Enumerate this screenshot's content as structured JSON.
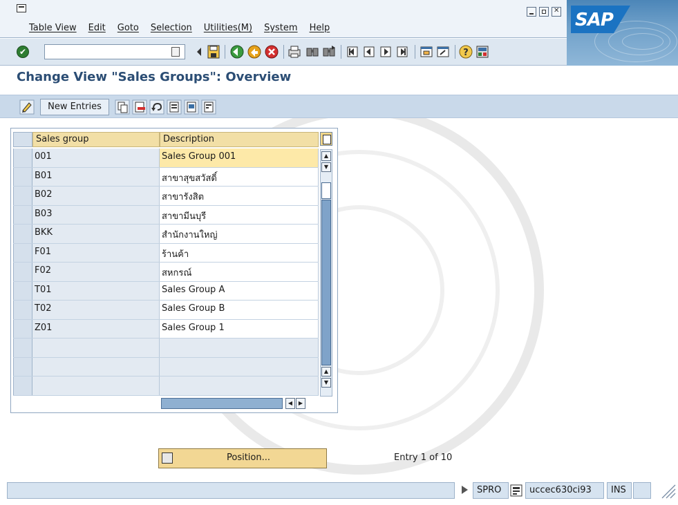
{
  "menu": {
    "items": [
      "Table View",
      "Edit",
      "Goto",
      "Selection",
      "Utilities(M)",
      "System",
      "Help"
    ]
  },
  "logo": {
    "text": "SAP"
  },
  "toolbar": {
    "command_value": "",
    "icons": [
      "enter-icon",
      "save-icon",
      "back-icon",
      "exit-icon",
      "cancel-icon",
      "print-icon",
      "find-icon",
      "find-next-icon",
      "first-page-icon",
      "previous-page-icon",
      "next-page-icon",
      "last-page-icon",
      "create-session-icon",
      "shortcut-icon",
      "help-icon",
      "customize-layout-icon"
    ]
  },
  "page": {
    "title": "Change View \"Sales Groups\": Overview"
  },
  "app_toolbar": {
    "new_entries_label": "New Entries",
    "icons": [
      "change-display-icon",
      "copy-icon",
      "delete-icon",
      "undo-icon",
      "select-all-icon",
      "select-block-icon",
      "deselect-all-icon"
    ]
  },
  "table": {
    "columns": [
      "Sales group",
      "Description"
    ],
    "rows": [
      {
        "group": "001",
        "description": "Sales Group 001"
      },
      {
        "group": "B01",
        "description": "สาขาสุขสวัสดิ์"
      },
      {
        "group": "B02",
        "description": "สาขารังสิต"
      },
      {
        "group": "B03",
        "description": "สาขามีนบุรี"
      },
      {
        "group": "BKK",
        "description": "สำนักงานใหญ่"
      },
      {
        "group": "F01",
        "description": "ร้านค้า"
      },
      {
        "group": "F02",
        "description": "สหกรณ์"
      },
      {
        "group": "T01",
        "description": "Sales Group A"
      },
      {
        "group": "T02",
        "description": "Sales Group B"
      },
      {
        "group": "Z01",
        "description": "Sales Group 1"
      }
    ],
    "empty_rows": 3
  },
  "position_button": {
    "label": "Position..."
  },
  "entry_info": "Entry 1 of 10",
  "status": {
    "transaction": "SPRO",
    "server": "uccec630ci93",
    "mode": "INS"
  },
  "colors": {
    "title": "#2b4d74",
    "header_cell": "#f2dfa6",
    "active_cell": "#fde9a8",
    "app_toolbar": "#c9d9ea"
  }
}
